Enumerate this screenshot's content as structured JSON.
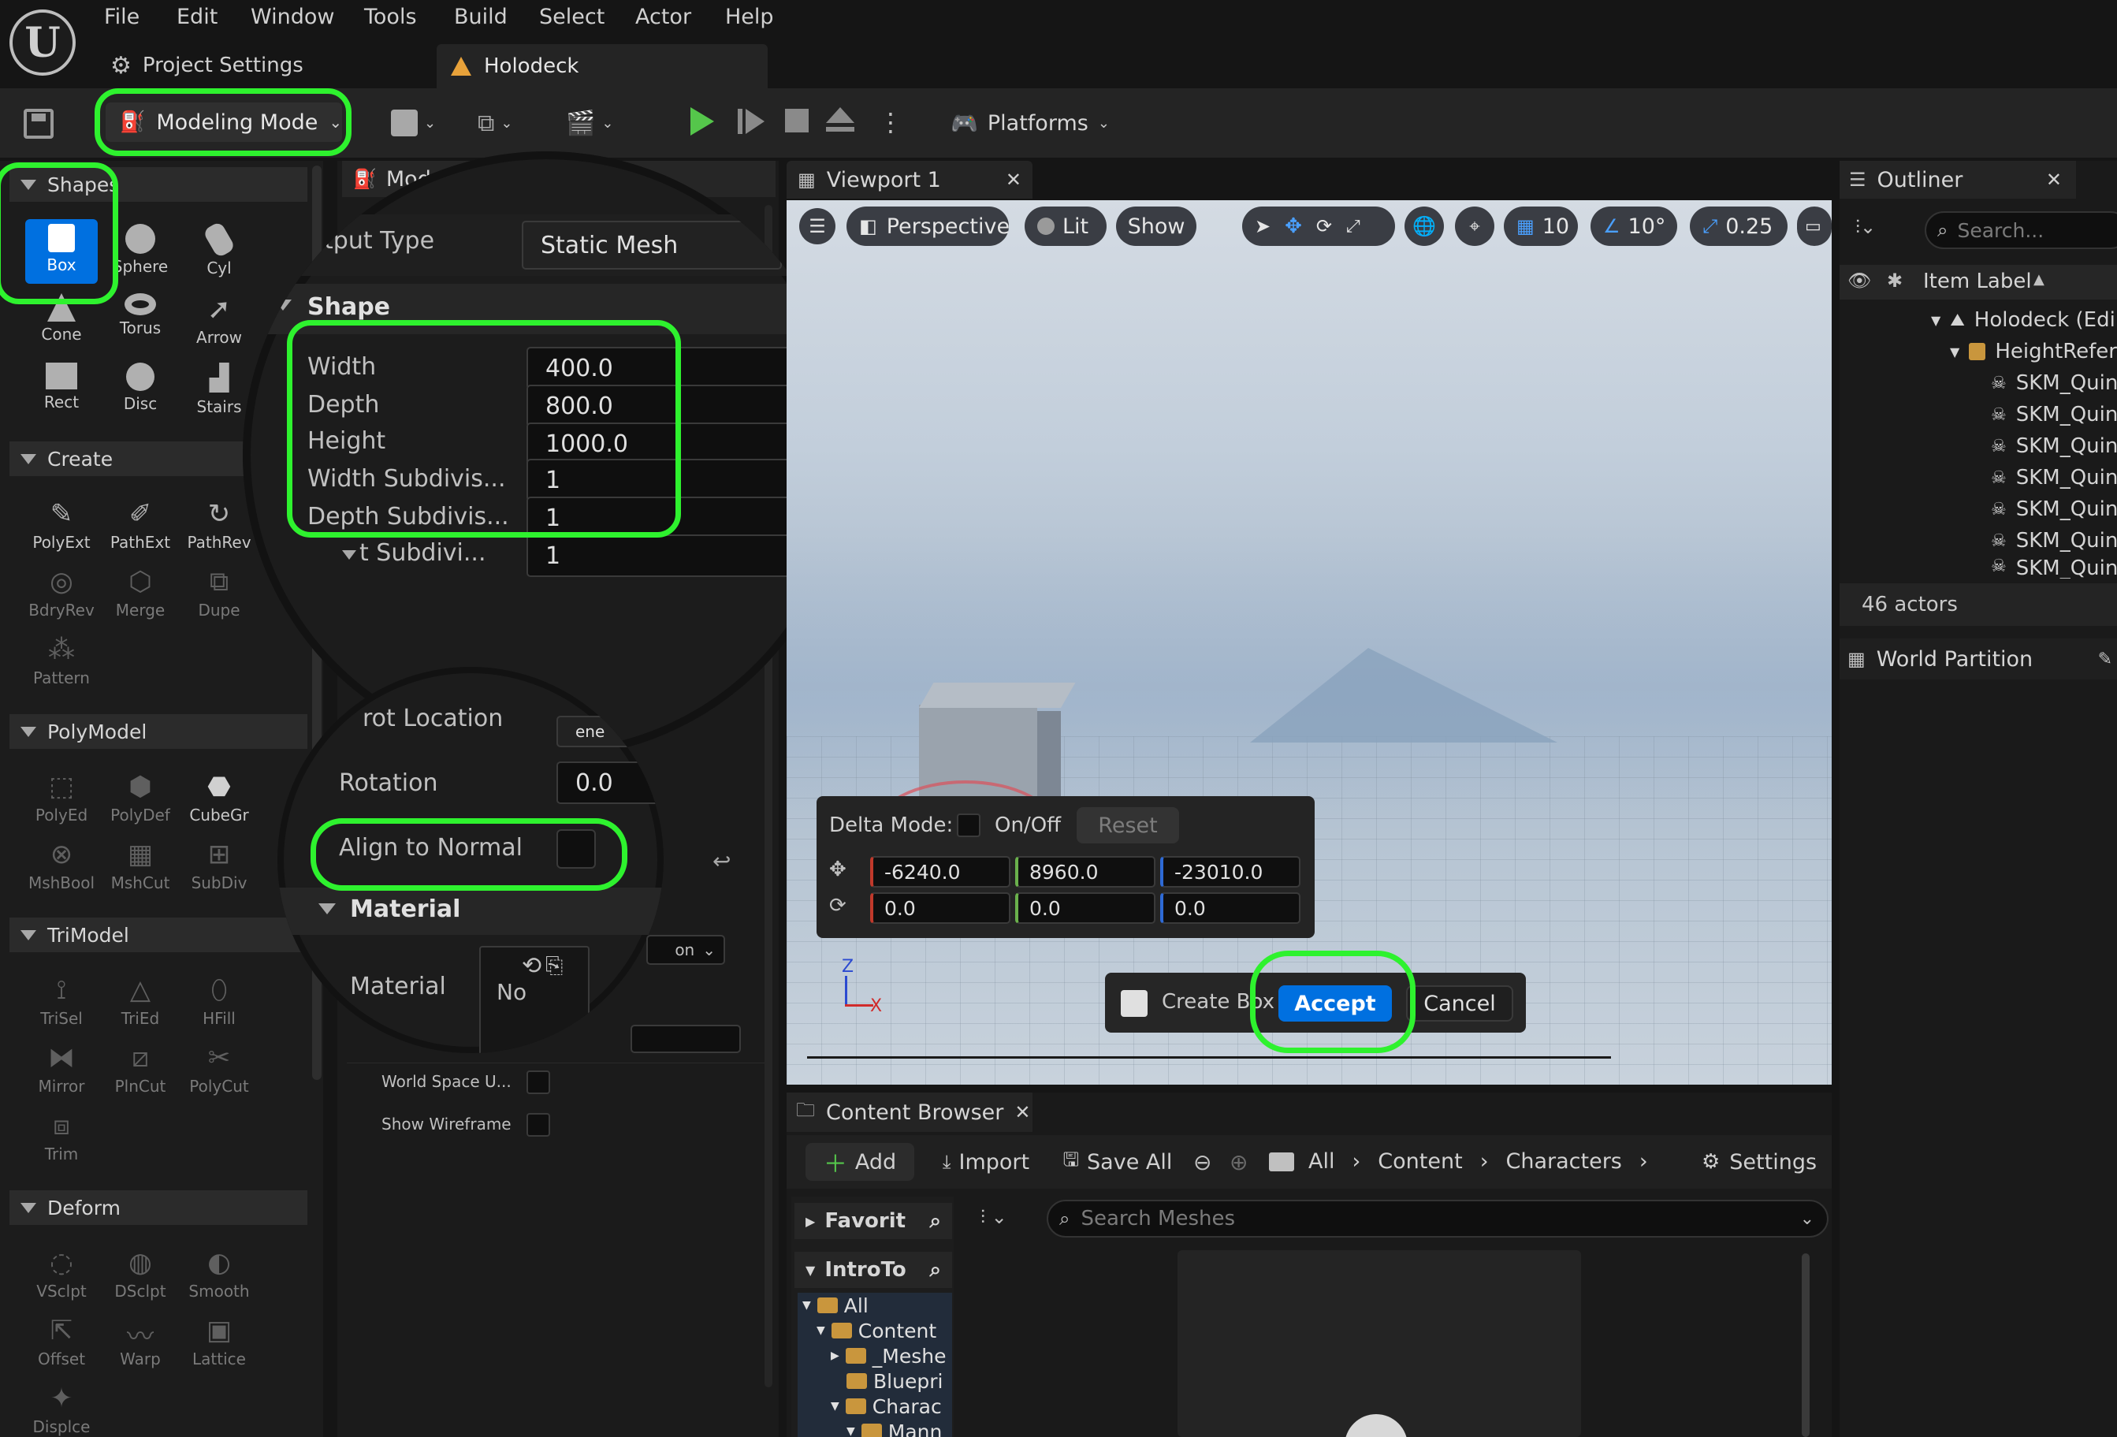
{
  "menu": [
    "File",
    "Edit",
    "Window",
    "Tools",
    "Build",
    "Select",
    "Actor",
    "Help"
  ],
  "tabs": {
    "project_settings": "Project Settings",
    "level": "Holodeck"
  },
  "toolbar": {
    "mode": "Modeling Mode",
    "platforms": "Platforms"
  },
  "tool_palette": {
    "shapes_header": "Shapes",
    "shapes": [
      "Box",
      "Sphere",
      "Cyl",
      "Cone",
      "Torus",
      "Arrow",
      "Rect",
      "Disc",
      "Stairs"
    ],
    "create_header": "Create",
    "create": [
      "PolyExt",
      "PathExt",
      "PathRev",
      "BdryRev",
      "Merge",
      "Dupe",
      "Pattern"
    ],
    "polymodel_header": "PolyModel",
    "polymodel": [
      "PolyEd",
      "PolyDef",
      "CubeGr",
      "MshBool",
      "MshCut",
      "SubDiv"
    ],
    "trimodel_header": "TriModel",
    "trimodel": [
      "TriSel",
      "TriEd",
      "HFill",
      "Mirror",
      "PlnCut",
      "PolyCut",
      "Trim"
    ],
    "deform_header": "Deform",
    "deform": [
      "VSclpt",
      "DSclpt",
      "Smooth",
      "Offset",
      "Warp",
      "Lattice",
      "Displce"
    ]
  },
  "details": {
    "header": "Mode",
    "output_type_label": "utput Type",
    "output_type_value": "Static Mesh",
    "shape_section": "Shape",
    "width_label": "Width",
    "width_value": "400.0",
    "depth_label": "Depth",
    "depth_value": "800.0",
    "height_label": "Height",
    "height_value": "1000.0",
    "width_subdiv_label": "Width Subdivis...",
    "width_subdiv_value": "1",
    "depth_subdiv_label": "Depth Subdivis...",
    "depth_subdiv_value": "1",
    "height_subdiv_label": "t Subdivi...",
    "height_subdiv_value": "1",
    "pivot_label": "rot Location",
    "pivot_value": "ene",
    "rotation_label": "Rotation",
    "rotation_value": "0.0",
    "align_label": "Align to Normal",
    "material_section": "Material",
    "material_label": "Material",
    "material_value": "No",
    "material_dropdown": "on",
    "world_space_label": "World Space U...",
    "show_wireframe_label": "Show Wireframe"
  },
  "viewport": {
    "tab": "Viewport 1",
    "perspective": "Perspective",
    "lit": "Lit",
    "show": "Show",
    "grid_snap": "10",
    "rot_snap": "10°",
    "scale_snap": "0.25",
    "delta_mode_label": "Delta Mode:",
    "on_off": "On/Off",
    "reset": "Reset",
    "loc": [
      "-6240.0",
      "8960.0",
      "-23010.0"
    ],
    "rot": [
      "0.0",
      "0.0",
      "0.0"
    ],
    "create_label": "Create Box",
    "accept": "Accept",
    "cancel": "Cancel",
    "axis_z": "Z",
    "axis_x": "X"
  },
  "outliner": {
    "tab": "Outliner",
    "search_placeholder": "Search...",
    "column": "Item Label",
    "rows": [
      "Holodeck (Edi",
      "HeightRefer",
      "SKM_Quin",
      "SKM_Quin",
      "SKM_Quin",
      "SKM_Quin",
      "SKM_Quin",
      "SKM_Quin",
      "SKM_Quin"
    ],
    "count": "46 actors",
    "world_partition": "World Partition"
  },
  "content_browser": {
    "tab": "Content Browser",
    "add": "Add",
    "import": "Import",
    "save_all": "Save All",
    "breadcrumb": [
      "All",
      "Content",
      "Characters"
    ],
    "settings": "Settings",
    "favorites": "Favorit",
    "introto": "IntroTo",
    "search_placeholder": "Search Meshes",
    "tree": [
      "All",
      "Content",
      "_Meshe",
      "Bluepri",
      "Charac",
      "Mann"
    ]
  },
  "colors": {
    "highlight": "#2ef22e",
    "accent": "#0070e0",
    "play": "#55c64b"
  }
}
